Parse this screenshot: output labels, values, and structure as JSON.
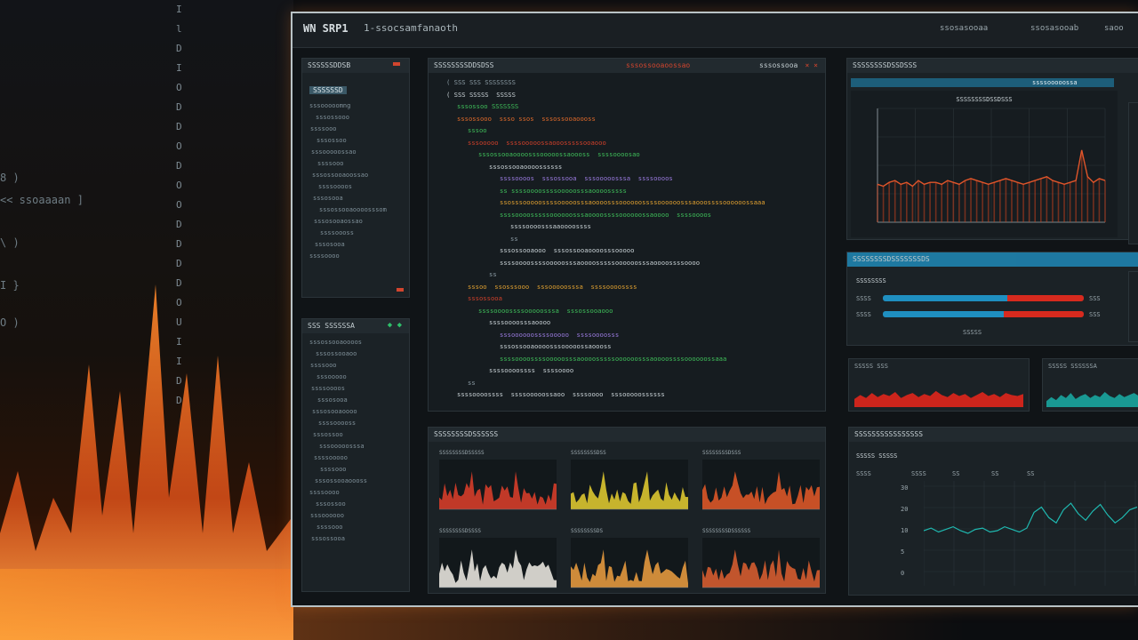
{
  "background": {
    "left_text": [
      "8 )",
      "<< ssoaaaan ]",
      "\\ )",
      "I }",
      "O )"
    ],
    "column_glyphs": [
      "I",
      "l",
      "D",
      "I",
      "O",
      "D",
      "D",
      "O",
      "D",
      "O",
      "O",
      "D",
      "D",
      "D",
      "D",
      "O",
      "U",
      "I",
      "I",
      "D",
      "D"
    ]
  },
  "app": {
    "title": "WN SRP1",
    "subtitle": "1-ssocsamfanaoth",
    "menu": [
      "ssosasooaa",
      "ssosasooab",
      "saoo"
    ]
  },
  "sidebar_top": {
    "header": "SSSSSSDDSB",
    "active_item": "SSSSSSD",
    "items": [
      "sssooooomng",
      "sssossooo",
      "ssssooo",
      "sssossoo",
      "sssooooossao",
      "ssssooo",
      "sssossooaoossao",
      "ssssoooos",
      "sssosooa",
      "sssossooaoooosssom",
      "sssosooaossao",
      "ssssoooss",
      "sssosooa",
      "ssssoooo"
    ]
  },
  "sidebar_bottom": {
    "header": "SSS SSSSSSA",
    "items": [
      "sssossooaoooos",
      "sssossooaoo",
      "ssssooo",
      "sssooooo",
      "ssssoooos",
      "sssosooa",
      "sssosooaoooo",
      "ssssooooss",
      "sssossoo",
      "sssooooosssa",
      "ssssooooo",
      "ssssooo",
      "sssossooaoooss",
      "ssssoooo",
      "sssossoo",
      "sssoooooo",
      "ssssooo",
      "sssossooa"
    ]
  },
  "editor": {
    "title": "SSSSSSSSDDSDSS",
    "tabs": [
      "sssossooaoossao",
      "sssossooa"
    ],
    "lines": [
      {
        "indent": 1,
        "text": "( SSS SSS SSSSSSSS",
        "color": "#8a9aa3"
      },
      {
        "indent": 1,
        "text": "( SSS SSSSS  SSSSS",
        "color": "#c9d2d6"
      },
      {
        "indent": 2,
        "text": "sssossoo SSSSSSS",
        "color": "#3fbf5a"
      },
      {
        "indent": 2,
        "text": "sssossooo  ssso ssos  sssossooaoooss",
        "color": "#e06a2a"
      },
      {
        "indent": 3,
        "text": "sssoo",
        "color": "#3fbf5a"
      },
      {
        "indent": 3,
        "text": "sssooooo  ssssooooossaooosssssooaooo",
        "color": "#d0402a"
      },
      {
        "indent": 4,
        "text": "sssossooaoooosssooooossaoooss  ssssoooosao",
        "color": "#3fbf5a"
      },
      {
        "indent": 5,
        "text": "sssossooaoooossssss",
        "color": "#c9d2d6"
      },
      {
        "indent": 6,
        "text": "ssssoooos  sssossooa  sssooooosssa  ssssoooos",
        "color": "#9b7be0"
      },
      {
        "indent": 6,
        "text": "ss ssssoooossssooooosssaoooosssss",
        "color": "#3fbf5a"
      },
      {
        "indent": 6,
        "text": "ssosssooooossssooooosssaoooosssoooooossssoooooosssaooossssoooooossaaa",
        "color": "#e0a030"
      },
      {
        "indent": 6,
        "text": "ssssoooosssssoooooosssaoooossssoooooossaoooo  ssssoooos",
        "color": "#3fbf5a"
      },
      {
        "indent": 7,
        "text": "ssssoooosssaaoooossss",
        "color": "#c9d2d6"
      },
      {
        "indent": 7,
        "text": "ss",
        "color": "#8a9aa3"
      },
      {
        "indent": 6,
        "text": "sssossooaooo  sssossooaoooosssooooo",
        "color": "#c9d2d6"
      },
      {
        "indent": 6,
        "text": "ssssoooossssooooosssaoooosssssoooooosssaoooossssoooo",
        "color": "#c9d2d6"
      },
      {
        "indent": 5,
        "text": "ss",
        "color": "#8a9aa3"
      },
      {
        "indent": 3,
        "text": "sssoo  ssosssooo  sssooooosssa  ssssoooossss",
        "color": "#e0a030"
      },
      {
        "indent": 3,
        "text": "sssossooa",
        "color": "#d0402a"
      },
      {
        "indent": 4,
        "text": "ssssoooossssooooosssa  sssossooaooo",
        "color": "#3fbf5a"
      },
      {
        "indent": 5,
        "text": "ssssoooosssaoooo",
        "color": "#c9d2d6"
      },
      {
        "indent": 6,
        "text": "sssoooooossssooooo  ssssoooosss",
        "color": "#9b7be0"
      },
      {
        "indent": 6,
        "text": "sssossooaoooosssooooossaoooss",
        "color": "#c9d2d6"
      },
      {
        "indent": 6,
        "text": "ssssoooossssooooosssaoooosssssoooooosssaoooossssoooooossaaa",
        "color": "#3fbf5a"
      },
      {
        "indent": 5,
        "text": "ssssoooossss  ssssoooo",
        "color": "#c9d2d6"
      },
      {
        "indent": 3,
        "text": "ss",
        "color": "#8a9aa3"
      },
      {
        "indent": 2,
        "text": "ssssoooossss  ssssooooossaoo  ssssoooo  sssooooossssss",
        "color": "#c9d2d6"
      }
    ]
  },
  "main_chart": {
    "panel_title": "SSSSSSSSDSSDSSS",
    "header_right": "ssssooooossa",
    "chart_title": "SSSSSSSSDSSDSSS",
    "accent": "#e0552a"
  },
  "chart_data": [
    {
      "type": "line",
      "title": "SSSSSSSSDSSDSSS",
      "x": [
        0,
        1,
        2,
        3,
        4,
        5,
        6,
        7,
        8,
        9,
        10,
        11,
        12,
        13,
        14,
        15,
        16,
        17,
        18,
        19,
        20,
        21,
        22,
        23,
        24,
        25,
        26,
        27,
        28,
        29,
        30,
        31,
        32,
        33,
        34,
        35,
        36,
        37,
        38,
        39
      ],
      "series": [
        {
          "values": [
            20,
            19,
            21,
            22,
            20,
            21,
            19,
            22,
            20,
            21,
            21,
            20,
            22,
            21,
            20,
            22,
            23,
            22,
            21,
            20,
            21,
            22,
            23,
            22,
            21,
            20,
            21,
            22,
            23,
            24,
            22,
            21,
            20,
            21,
            22,
            38,
            24,
            21,
            23,
            22
          ]
        }
      ],
      "ylim": [
        0,
        60
      ]
    },
    {
      "type": "bar",
      "title": "SSSSSSSS",
      "series": [
        {
          "values": [
            0.62,
            0.38
          ]
        },
        {
          "values": [
            0.6,
            0.4
          ]
        }
      ]
    },
    {
      "type": "area",
      "title": "SSSSS SSS",
      "series": [
        {
          "values": [
            8,
            12,
            9,
            14,
            10,
            13,
            11,
            15,
            9,
            12,
            14,
            10,
            13,
            11,
            16,
            12,
            10,
            14,
            11,
            13,
            9,
            12,
            15,
            11,
            13,
            10,
            14,
            12,
            11,
            13
          ]
        }
      ],
      "ylim": [
        0,
        30
      ]
    },
    {
      "type": "area",
      "title": "SSSSS SSSSSSA",
      "series": [
        {
          "values": [
            6,
            10,
            7,
            12,
            9,
            14,
            8,
            11,
            13,
            9,
            12,
            10,
            15,
            11,
            9,
            13,
            10,
            12,
            14,
            11
          ]
        }
      ],
      "ylim": [
        0,
        30
      ]
    },
    {
      "type": "line",
      "title": "SSSS SSSS",
      "x": [
        0,
        1,
        2,
        3,
        4,
        5,
        6,
        7,
        8,
        9,
        10,
        11,
        12,
        13,
        14,
        15,
        16,
        17,
        18,
        19,
        20,
        21,
        22,
        23,
        24,
        25,
        26,
        27,
        28,
        29
      ],
      "series": [
        {
          "values": [
            42,
            44,
            41,
            43,
            45,
            42,
            40,
            43,
            44,
            41,
            42,
            45,
            43,
            41,
            44,
            56,
            60,
            52,
            48,
            58,
            63,
            55,
            50,
            57,
            62,
            54,
            48,
            52,
            58,
            60
          ]
        }
      ],
      "ylim": [
        0,
        80
      ]
    }
  ],
  "bars_panel": {
    "title": "SSSSSSSSDSSSSSSSDS",
    "section": "SSSSSSSS",
    "row_labels": [
      "SSSS",
      "SSSS"
    ],
    "end_labels": [
      "SSS",
      "SSS"
    ],
    "footer": "SSSSS"
  },
  "mini_right": {
    "red_title": "SSSSS SSS",
    "teal_title": "SSSSS SSSSSSA"
  },
  "stream_panel": {
    "title": "SSSSSSSSSSSSSSSS",
    "subtitle": "SSSSS SSSSS",
    "cols": [
      "SSSS",
      "SSSS",
      "SS",
      "SS",
      "SS"
    ],
    "ylabels": [
      "30",
      "20",
      "10",
      "5",
      "0"
    ]
  },
  "grid_panel": {
    "title": "SSSSSSSSDSSSSSS",
    "charts": [
      {
        "label": "SSSSSSSSDSSSSS",
        "color": "#e0402a"
      },
      {
        "label": "SSSSSSSSDSS",
        "color": "#e8d030"
      },
      {
        "label": "SSSSSSSSDSSS",
        "color": "#e85a28"
      },
      {
        "label": "SSSSSSSSDSSSS",
        "color": "#f2efe6"
      },
      {
        "label": "SSSSSSSSDS",
        "color": "#f0a040"
      },
      {
        "label": "SSSSSSSSDSSSSSS",
        "color": "#e06030"
      }
    ]
  }
}
